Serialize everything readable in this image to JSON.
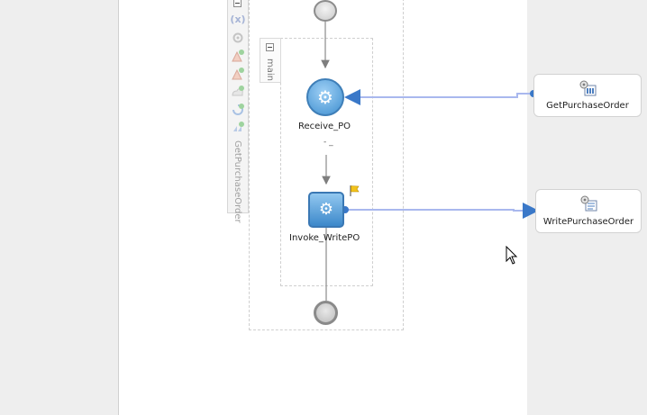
{
  "process": {
    "scope_name": "main",
    "partner_tab_label": "GetPurchaseOrder",
    "activities": {
      "receive": {
        "label": "Receive_PO"
      },
      "invoke": {
        "label": "Invoke_WritePO"
      }
    },
    "connector_caption": "- _"
  },
  "partner_links": {
    "get": {
      "label": "GetPurchaseOrder"
    },
    "write": {
      "label": "WritePurchaseOrder"
    }
  },
  "toolbar": {
    "variables_label": "(x)"
  },
  "icons": {
    "activity": "gear-icon",
    "warning": "flag-icon",
    "partner": "service-icon",
    "pointer": "mouse-cursor"
  },
  "colors": {
    "canvas": "#ffffff",
    "background": "#eeeeee",
    "activity_blue": "#3f8fd0",
    "wire": "#a9b8ee",
    "wire_end": "#3a78c8"
  }
}
